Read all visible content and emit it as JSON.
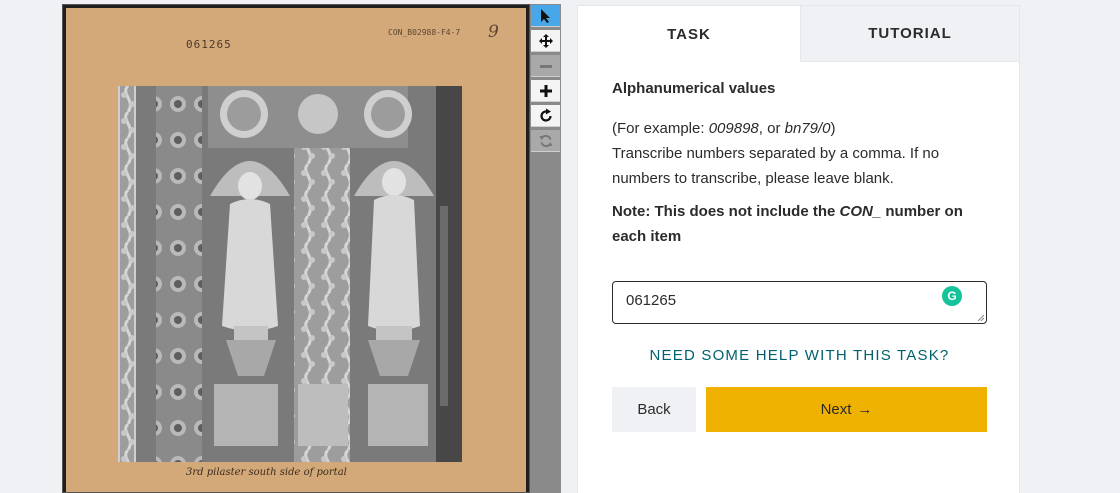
{
  "viewer": {
    "card_number": "061265",
    "card_code": "CON_B02988-F4-7",
    "card_code_handwritten": "9",
    "card_caption": "3rd pilaster  south side of portal"
  },
  "toolbar": {
    "tools": [
      {
        "name": "select-pointer-icon",
        "state": "active"
      },
      {
        "name": "move-arrows-icon",
        "state": "normal"
      },
      {
        "name": "zoom-out-icon",
        "state": "disabled"
      },
      {
        "name": "zoom-in-icon",
        "state": "normal"
      },
      {
        "name": "rotate-icon",
        "state": "normal"
      },
      {
        "name": "reset-icon",
        "state": "disabled"
      }
    ]
  },
  "tabs": {
    "task": "TASK",
    "tutorial": "TUTORIAL"
  },
  "task": {
    "title": "Alphanumerical values",
    "example_prefix": "(For example: ",
    "example_1": "009898",
    "example_sep": ", or ",
    "example_2": "bn79/0",
    "example_suffix": ")",
    "instructions": "Transcribe numbers separated by a comma. If no numbers to transcribe, please leave blank.",
    "note_prefix": "Note: This does not include the ",
    "note_em": "CON_",
    "note_suffix": " number on each item",
    "input_value": "061265",
    "grammarly_letter": "G",
    "help_link": "NEED SOME HELP WITH THIS TASK?",
    "back_label": "Back",
    "next_label": "Next",
    "next_arrow": "→"
  },
  "colors": {
    "accent_tool": "#47a7e8",
    "next_button": "#f0b200",
    "help_link": "#00626d",
    "grammarly": "#15c39a"
  }
}
